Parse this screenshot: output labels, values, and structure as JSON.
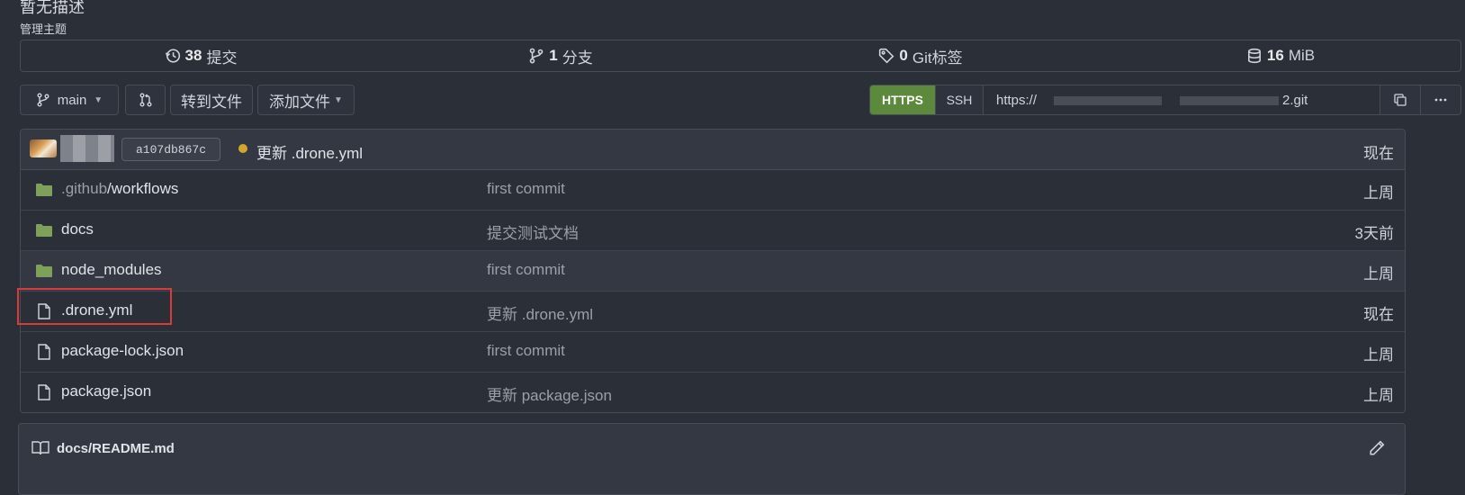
{
  "repo": {
    "description": "暂无描述",
    "topics_label": "管理主题"
  },
  "stats": [
    {
      "icon": "history-icon",
      "count": "38",
      "label": "提交"
    },
    {
      "icon": "branch-icon",
      "count": "1",
      "label": "分支"
    },
    {
      "icon": "tag-icon",
      "count": "0",
      "label": "Git标签"
    },
    {
      "icon": "database-icon",
      "count": "16",
      "label": "MiB"
    }
  ],
  "toolbar": {
    "branch": "main",
    "goto_file": "转到文件",
    "add_file": "添加文件",
    "clone_https": "HTTPS",
    "clone_ssh": "SSH",
    "clone_url_prefix": "https://",
    "clone_url_suffix": "2.git"
  },
  "latest_commit": {
    "sha": "a107db867c",
    "message": "更新 .drone.yml",
    "time": "现在",
    "status_color": "#d4a72c"
  },
  "files": [
    {
      "type": "folder",
      "name_muted": ".github",
      "name": "/workflows",
      "message": "first commit",
      "time": "上周"
    },
    {
      "type": "folder",
      "name_muted": "",
      "name": "docs",
      "message": "提交测试文档",
      "time": "3天前"
    },
    {
      "type": "folder",
      "name_muted": "",
      "name": "node_modules",
      "message": "first commit",
      "time": "上周"
    },
    {
      "type": "file",
      "name_muted": "",
      "name": ".drone.yml",
      "message": "更新 .drone.yml",
      "time": "现在"
    },
    {
      "type": "file",
      "name_muted": "",
      "name": "package-lock.json",
      "message": "first commit",
      "time": "上周"
    },
    {
      "type": "file",
      "name_muted": "",
      "name": "package.json",
      "message": "更新 package.json",
      "time": "上周"
    }
  ],
  "readme": {
    "path": "docs/README.md"
  },
  "colors": {
    "accent_green": "#5b8a3c",
    "folder": "#7fa05a",
    "highlight": "#d93b3b"
  }
}
